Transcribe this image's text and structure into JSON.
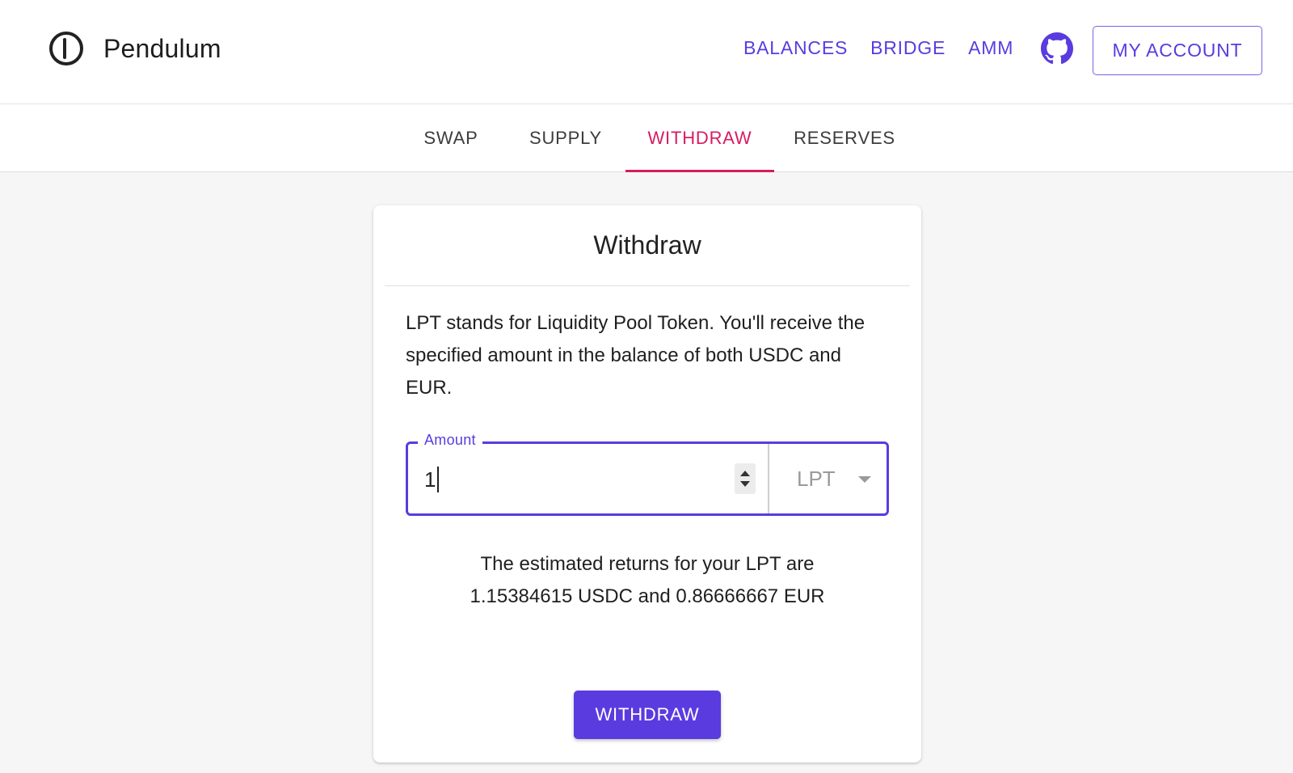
{
  "header": {
    "brand_name": "Pendulum",
    "nav": [
      "BALANCES",
      "BRIDGE",
      "AMM"
    ],
    "account_label": "MY ACCOUNT",
    "icons": {
      "logo": "pendulum-logo-icon",
      "github": "github-icon"
    }
  },
  "tabs": {
    "items": [
      "SWAP",
      "SUPPLY",
      "WITHDRAW",
      "RESERVES"
    ],
    "active": "WITHDRAW"
  },
  "card": {
    "title": "Withdraw",
    "description": "LPT stands for Liquidity Pool Token. You'll receive the specified amount in the balance of both USDC and EUR.",
    "amount_label": "Amount",
    "amount_value": "1",
    "token": "LPT",
    "returns_line1": "The estimated returns for your LPT are",
    "returns_line2": "1.15384615 USDC and 0.86666667 EUR",
    "submit_label": "WITHDRAW"
  },
  "colors": {
    "accent": "#5a3be0",
    "tab_active": "#d81b60",
    "background": "#f6f6f6"
  }
}
